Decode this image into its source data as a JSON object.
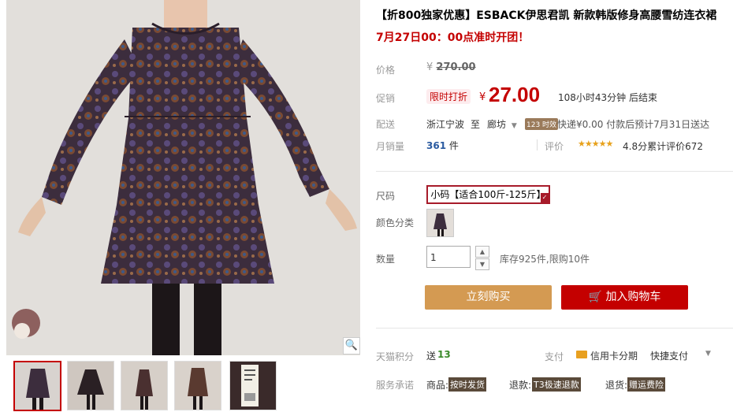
{
  "product": {
    "title": "【折800独家优惠】ESBACK伊思君凯 新款韩版修身高腰雪纺连衣裙",
    "subtitle": "7月27日00：00点准时开团！"
  },
  "price": {
    "label": "价格",
    "currency": "¥",
    "original": "270.00"
  },
  "promo": {
    "label": "促销",
    "badge": "限时打折",
    "currency": "¥",
    "price": "27.00",
    "countdown": "108小时43分钟 后结束"
  },
  "delivery": {
    "label": "配送",
    "from": "浙江宁波",
    "to_word": "至",
    "to": "廊坊",
    "tag": "123 时效",
    "info": "快递¥0.00 付款后预计7月31日送达"
  },
  "sales": {
    "label": "月销量",
    "count": "361",
    "unit": "件",
    "review_label": "评价",
    "stars": "★★★★★",
    "review_text": "4.8分累计评价672"
  },
  "size": {
    "label": "尺码",
    "selected": "小码【适合100斤-125斤】"
  },
  "color": {
    "label": "颜色分类"
  },
  "quantity": {
    "label": "数量",
    "value": "1",
    "stock": "库存925件,限购10件"
  },
  "buttons": {
    "buy_now": "立刻购买",
    "add_cart": "加入购物车"
  },
  "points": {
    "label": "天猫积分",
    "give": "送",
    "amount": "13",
    "pay_label": "支付",
    "card_installment": "信用卡分期",
    "quick_pay": "快捷支付"
  },
  "service": {
    "label": "服务承诺",
    "goods_label": "商品:",
    "goods_tag": "按时发货",
    "refund_label": "退款:",
    "refund_tag": "T3极速退款",
    "return_label": "退货:",
    "return_tag": "赠运费险"
  },
  "colors": {
    "accent": "#c40000",
    "buy_button": "#d49a52",
    "cart_button": "#c40000"
  }
}
